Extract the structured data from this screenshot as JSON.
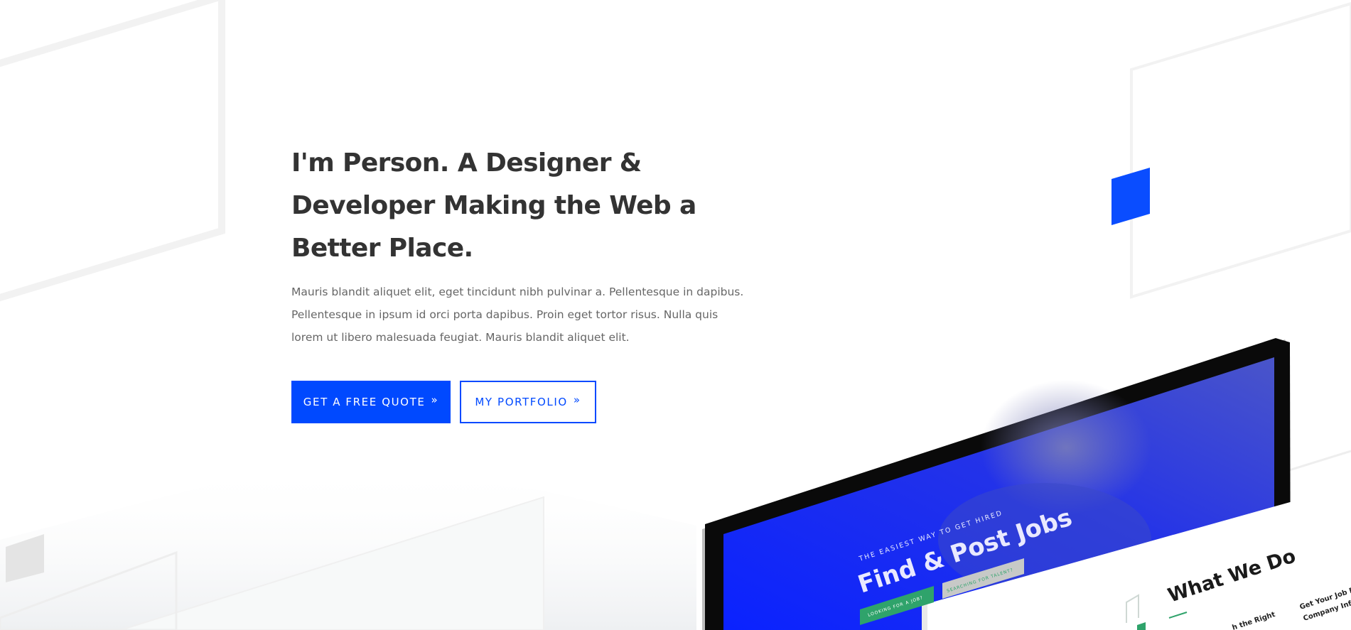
{
  "hero": {
    "title": "I'm Person. A Designer & Developer Making the Web a Better Place.",
    "description": "Mauris blandit aliquet elit, eget tincidunt nibh pulvinar a. Pellentesque in dapibus. Pellentesque in ipsum id orci porta dapibus. Proin eget tortor risus. Nulla quis lorem ut libero malesuada feugiat. Mauris blandit aliquet elit."
  },
  "buttons": {
    "primary_label": "GET A FREE QUOTE",
    "secondary_label": "MY PORTFOLIO",
    "chevron": "»"
  },
  "mockup": {
    "tagline": "THE EASIEST WAY TO GET HIRED",
    "headline": "Find & Post Jobs",
    "btn_job": "LOOKING FOR A JOB?",
    "btn_talent": "SEARCHING FOR TALENT?",
    "section_title": "What We Do",
    "col_text_1": "Get Your Job P",
    "col_text_2": "Company Info",
    "col_text_3": "h the Right"
  },
  "colors": {
    "accent": "#0049ff",
    "heading": "#333333",
    "body_text": "#666666",
    "mockup_green": "#2fa36b"
  }
}
